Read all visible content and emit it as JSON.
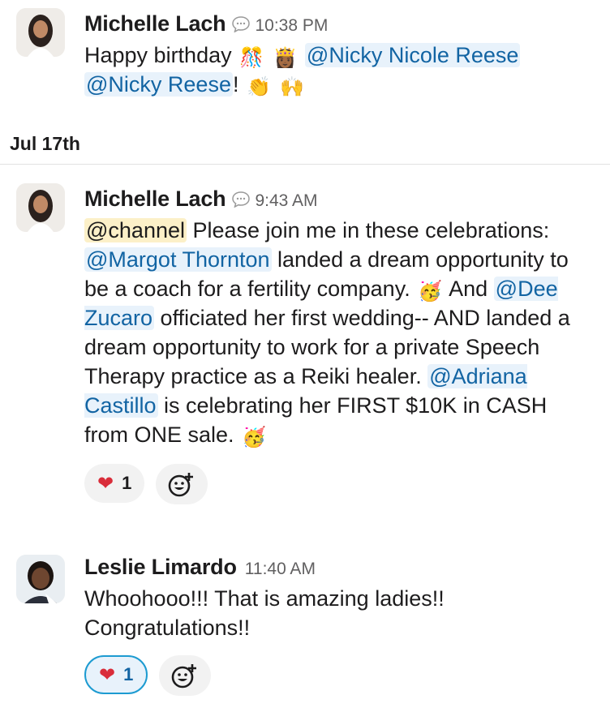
{
  "messages": [
    {
      "author": "Michelle Lach",
      "time": "10:38 PM",
      "text": {
        "t1": "Happy birthday ",
        "m1": "@Nicky Nicole Reese",
        "m2": "@Nicky Reese",
        "t2": "!"
      },
      "emojis": [
        "confetti-icon",
        "woman-crown-icon",
        "clapping-hands-icon",
        "raised-hands-icon"
      ]
    },
    {
      "author": "Michelle Lach",
      "time": "9:43 AM",
      "text": {
        "channel": "@channel",
        "t1": " Please join me in these celebrations: ",
        "m1": "@Margot Thornton",
        "t2": " landed a dream opportunity to be a coach for a fertility company. ",
        "t3": " And ",
        "m2": "@Dee Zucaro",
        "t4": " officiated her first wedding-- AND landed a dream opportunity to work for a private Speech Therapy practice as a Reiki healer. ",
        "m3": "@Adriana Castillo",
        "t5": " is celebrating her FIRST $10K in CASH from ONE sale. "
      },
      "reactions": [
        {
          "emoji": "heart-icon",
          "count": "1"
        }
      ]
    },
    {
      "author": "Leslie Limardo",
      "time": "11:40 AM",
      "text": {
        "line1": "Whoohooo!!! That is amazing ladies!!",
        "line2": "Congratulations!!"
      },
      "reactions": [
        {
          "emoji": "heart-icon",
          "count": "1",
          "active": true
        }
      ]
    }
  ],
  "day_divider": "Jul 17th",
  "colors": {
    "mention": "#1264a3",
    "mention_bg": "#e8f2fb",
    "channel_bg": "#fcf0c8",
    "heart": "#d92d3a",
    "active_border": "#1d9bd1"
  }
}
